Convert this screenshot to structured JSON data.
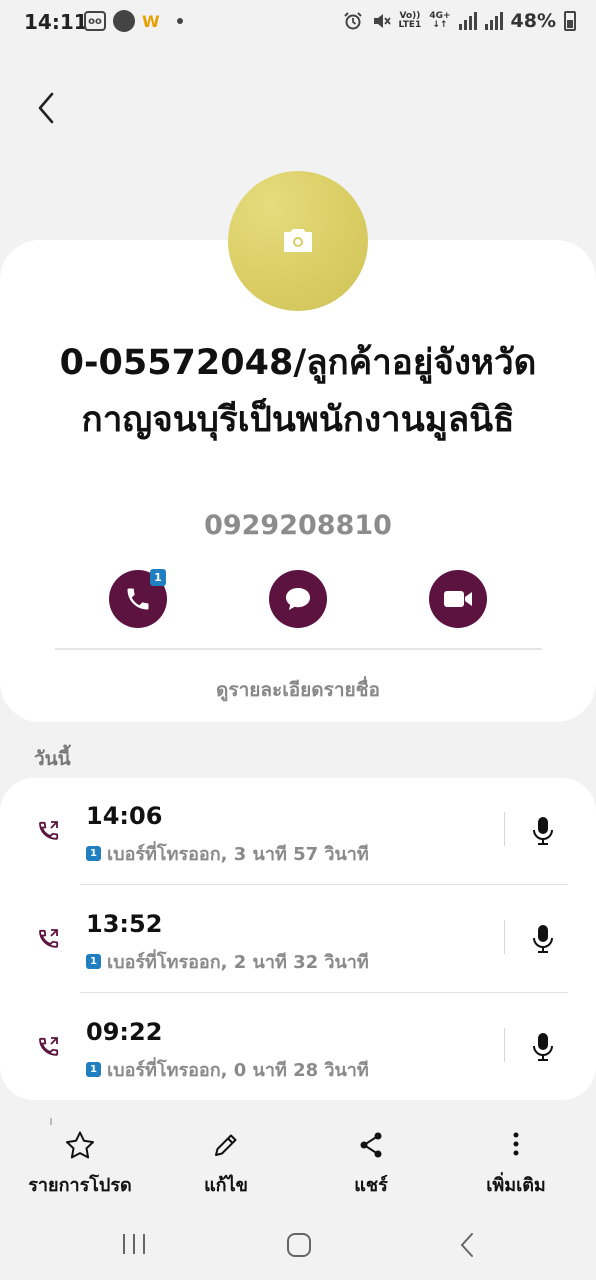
{
  "status_bar": {
    "time": "14:11",
    "volte": "Vo))",
    "lte": "LTE1",
    "network": "4G+",
    "battery": "48%"
  },
  "contact": {
    "name": "0-05572048/ลูกค้าอยู่จังหวัดกาญจนบุรีเป็นพนักงานมูลนิธิ",
    "phone": "0929208810",
    "sim_badge": "1",
    "details_link": "ดูรายละเอียดรายชื่อ"
  },
  "history": {
    "section_label": "วันนี้",
    "calls": [
      {
        "time": "14:06",
        "sim": "1",
        "detail": "เบอร์ที่โทรออก, 3 นาที 57 วินาที"
      },
      {
        "time": "13:52",
        "sim": "1",
        "detail": "เบอร์ที่โทรออก, 2 นาที 32 วินาที"
      },
      {
        "time": "09:22",
        "sim": "1",
        "detail": "เบอร์ที่โทรออก, 0 นาที 28 วินาที"
      }
    ]
  },
  "toolbar": {
    "favorite": "รายการโปรด",
    "edit": "แก้ไข",
    "share": "แชร์",
    "more": "เพิ่มเติม"
  },
  "colors": {
    "accent": "#5c1340",
    "avatar": "#d8cc62",
    "sim_badge": "#1f7fc0",
    "background": "#f2f2f2"
  }
}
